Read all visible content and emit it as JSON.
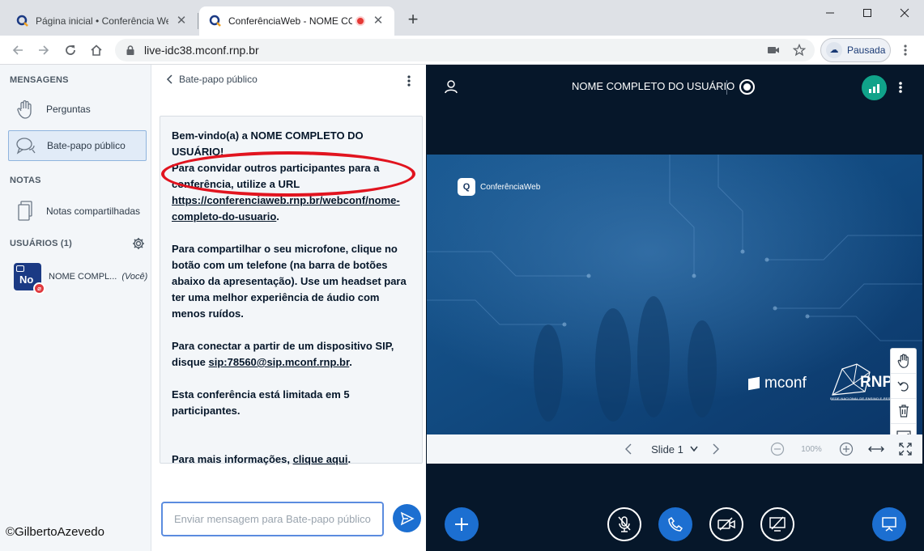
{
  "browser": {
    "tabs": [
      {
        "title": "Página inicial • Conferência Web",
        "active": false
      },
      {
        "title": "ConferênciaWeb - NOME CO",
        "active": true,
        "recording": true
      }
    ],
    "new_tab_symbol": "+",
    "url": "live-idc38.mconf.rnp.br",
    "profile_label": "Pausada"
  },
  "sidebar": {
    "messages_title": "MENSAGENS",
    "items": [
      {
        "label": "Perguntas",
        "icon": "hand-icon"
      },
      {
        "label": "Bate-papo público",
        "icon": "chat-icon",
        "active": true
      }
    ],
    "notes_title": "NOTAS",
    "notes_item": {
      "label": "Notas compartilhadas",
      "icon": "document-icon"
    },
    "users_title": "USUÁRIOS (1)",
    "user": {
      "initials": "No",
      "name": "NOME COMPL...",
      "you": "(Você)"
    }
  },
  "chat": {
    "title": "Bate-papo público",
    "welcome_line1_prefix": "Bem-vindo(a) a ",
    "welcome_line1_name": "NOME COMPLETO DO USUÁRIO!",
    "welcome_invite": "Para convidar outros participantes para a conferência, utilize a URL",
    "welcome_url": "https://conferenciaweb.rnp.br/webconf/nome-completo-do-usuario",
    "mic_text": "Para compartilhar o seu microfone, clique no botão com um telefone (na barra de botões abaixo da apresentação). Use um headset para ter uma melhor experiência de áudio com menos ruídos.",
    "sip_text_prefix": "Para conectar a partir de um dispositivo SIP, disque ",
    "sip_address": "sip:78560@sip.mconf.rnp.br",
    "limit_text": "Esta conferência está limitada em 5 participantes.",
    "more_info_prefix": "Para mais informações, ",
    "more_info_link": "clique aqui",
    "input_placeholder": "Enviar mensagem para Bate-papo público"
  },
  "stage": {
    "meeting_title": "NOME COMPLETO DO USUÁRIO",
    "slide": {
      "logo_text": "ConferênciaWeb",
      "mconf_text": "mconf",
      "rnp_text": "RNP",
      "rnp_sub": "REDE NACIONAL DE ENSINO E PESQUISA"
    },
    "slide_label": "Slide 1",
    "zoom": "100%"
  },
  "watermark": "©GilbertoAzevedo",
  "colors": {
    "stage_bg": "#06172a",
    "accent_blue": "#1c6fd1",
    "annotation_red": "#e1141f",
    "connection_green": "#10a38a"
  }
}
